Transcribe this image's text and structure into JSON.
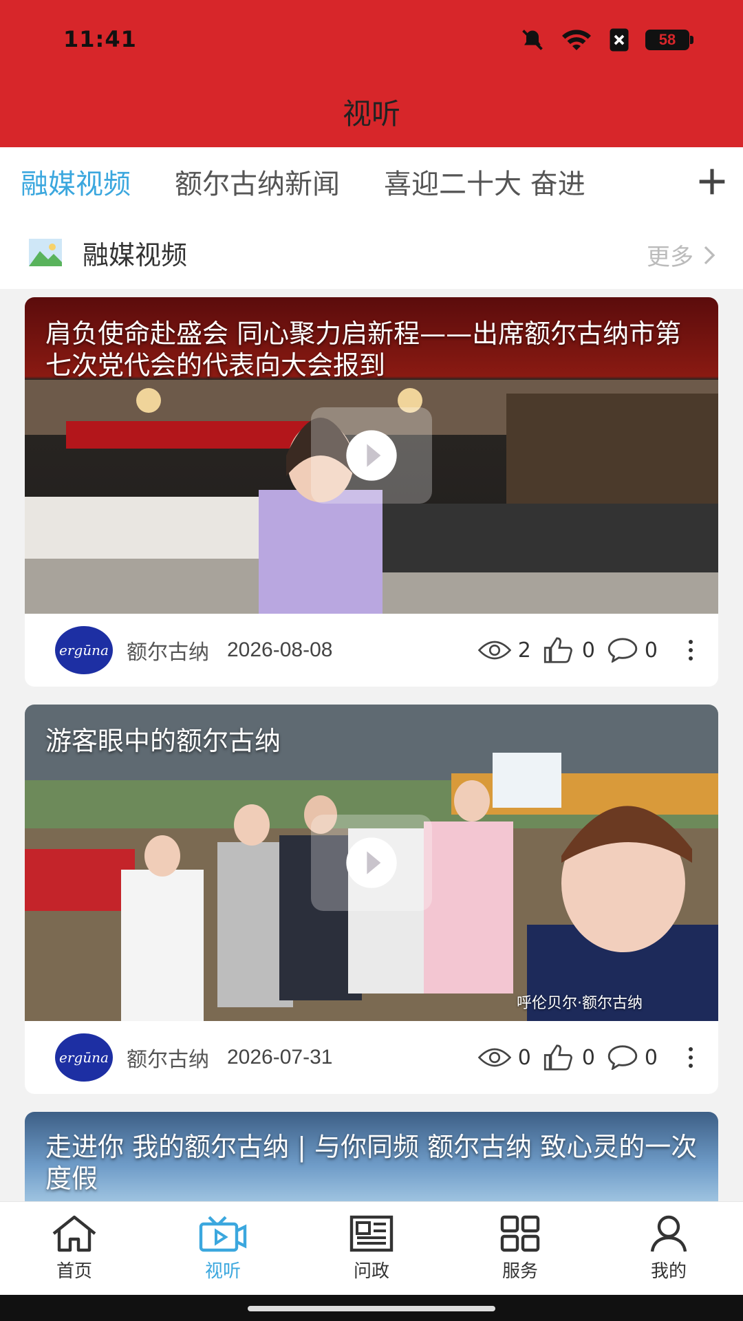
{
  "status": {
    "time": "11:41",
    "battery": "58"
  },
  "header": {
    "title": "视听"
  },
  "tabs": [
    {
      "label": "融媒视频"
    },
    {
      "label": "额尔古纳新闻"
    },
    {
      "label": "喜迎二十大 奋进"
    }
  ],
  "section": {
    "title": "融媒视频",
    "more": "更多"
  },
  "cards": [
    {
      "caption": "肩负使命赴盛会 同心聚力启新程——出席额尔古纳市第七次党代会的代表向大会报到",
      "source": "额尔古纳",
      "date": "2026-08-08",
      "views": "2",
      "likes": "0",
      "comments": "0"
    },
    {
      "caption": "游客眼中的额尔古纳",
      "watermark": "呼伦贝尔·额尔古纳",
      "source": "额尔古纳",
      "date": "2026-07-31",
      "views": "0",
      "likes": "0",
      "comments": "0"
    },
    {
      "caption": "走进你 我的额尔古纳 | 与你同频 额尔古纳 致心灵的一次度假"
    }
  ],
  "avatar_text": "ergūna",
  "nav": [
    {
      "label": "首页"
    },
    {
      "label": "视听"
    },
    {
      "label": "问政"
    },
    {
      "label": "服务"
    },
    {
      "label": "我的"
    }
  ],
  "colors": {
    "brand_red": "#d7262a",
    "accent_blue": "#3ba7de"
  }
}
